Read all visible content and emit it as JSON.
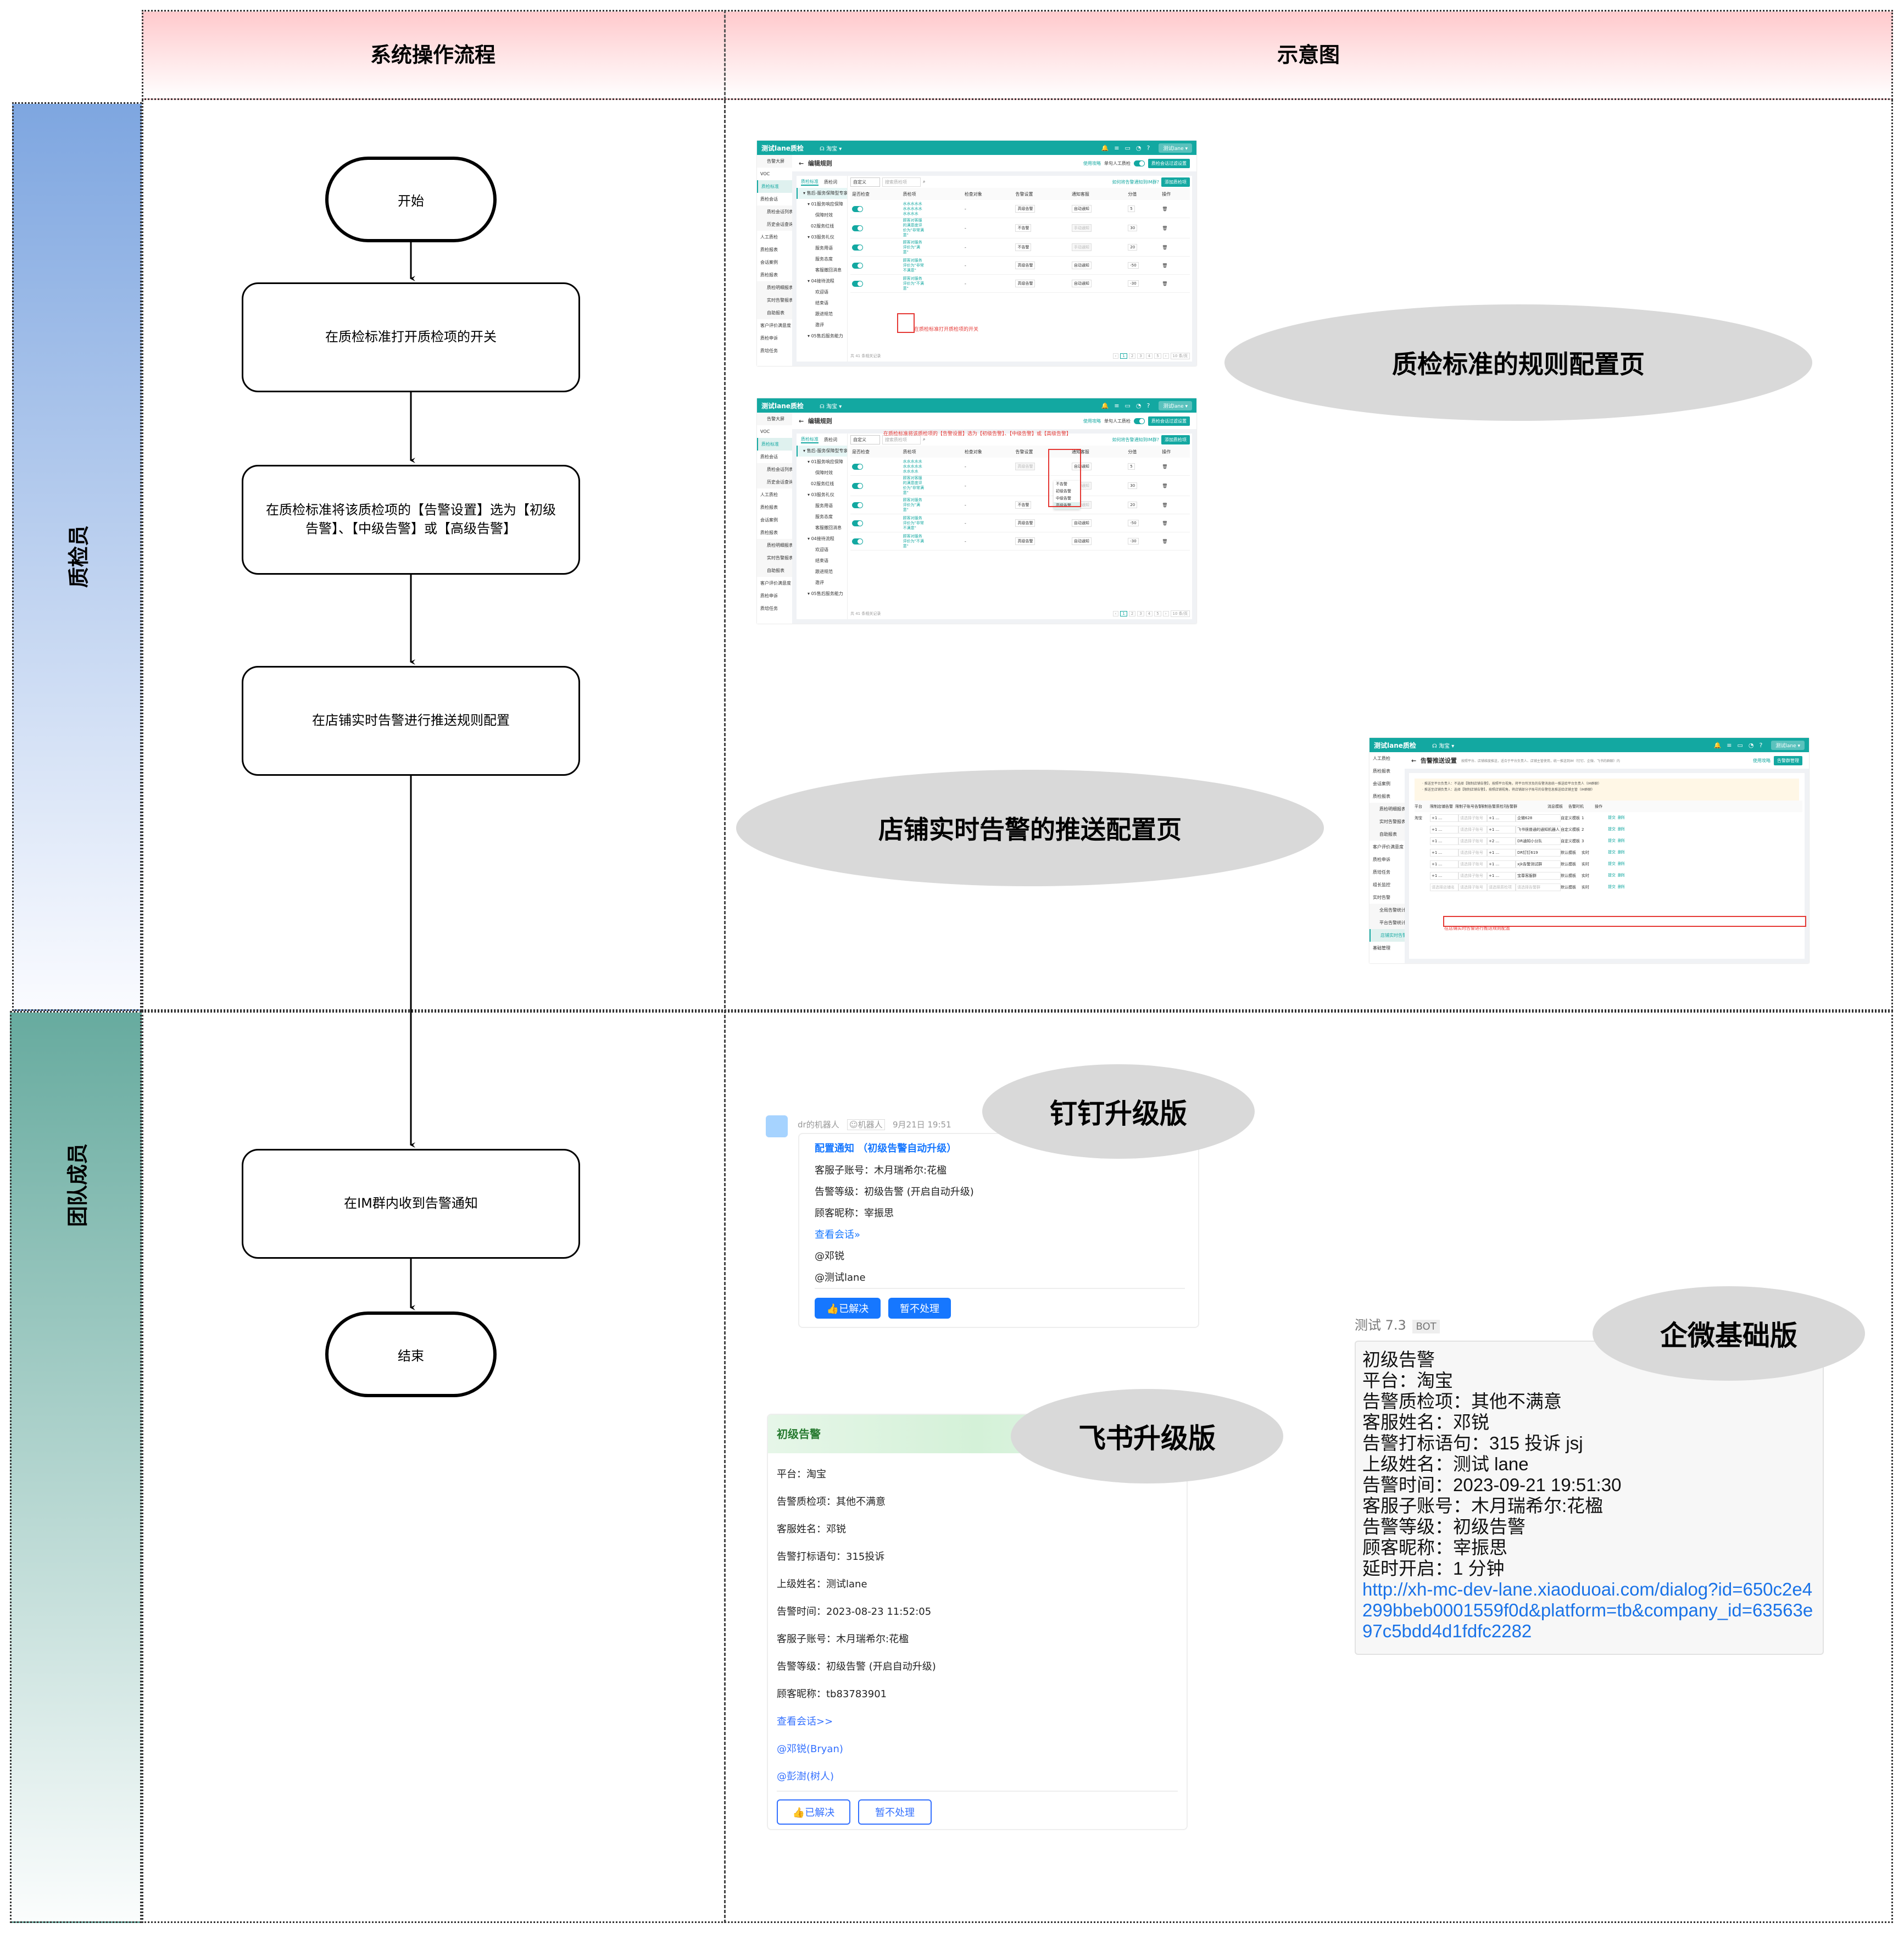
{
  "header": {
    "col_flow": "系统操作流程",
    "col_preview": "示意图"
  },
  "lanes": [
    {
      "label": "质检员",
      "color_top": "#7ea6e0"
    },
    {
      "label": "团队成员",
      "color_top": "#67ab9f"
    }
  ],
  "flow": {
    "start": "开始",
    "steps": [
      "在质检标准打开质检项的开关",
      "在质检标准将该质检项的【告警设置】选为【初级告警】、【中级告警】或【高级告警】",
      "在店铺实时告警进行推送规则配置",
      "在IM群内收到告警通知"
    ],
    "end": "结束"
  },
  "labels": {
    "rule_page": "质检标准的规则配置页",
    "push_page": "店铺实时告警的推送配置页",
    "dingtalk": "钉钉升级版",
    "feishu": "飞书升级版",
    "wecom": "企微基础版"
  },
  "app": {
    "brand": "测试lane质检",
    "platform": "淘宝 ▾",
    "user": "测试lane ▾",
    "accent": "#13a8a1",
    "sidebar": [
      "告警大屏",
      "VOC",
      "质检标准",
      "质检会话",
      "质检会话列表",
      "历史会话查询",
      "人工质检",
      "质检报表",
      "会话案例",
      "质检报表",
      "质检明细报表",
      "实时告警报表",
      "自助报表",
      "客户评价满意度",
      "质检申诉",
      "质培任务"
    ],
    "rule_page": {
      "title": "编辑规则",
      "guide_link": "使用攻略",
      "manual_label": "单句人工质检",
      "filter_button": "质检会话过滤设置",
      "tabs": [
        "质检标准",
        "质检词"
      ],
      "tree": [
        "售后-服务保障型专家",
        "01服务响应保障",
        "保障时效",
        "02服务红线",
        "03服务礼仪",
        "服务用语",
        "服务态度",
        "客服撤回消息",
        "04接待流程",
        "欢迎语",
        "结束语",
        "跟进规范",
        "邀评",
        "转接规范",
        "05售后服务能力"
      ],
      "filter_value": "自定义",
      "search_placeholder": "搜索质检项",
      "im_link": "如何将告警通知到IM群?",
      "add_button": "添加质检项",
      "columns": [
        "是否检查",
        "质检项",
        "调",
        "检查对象",
        "告警设置",
        "通知客服",
        "分值",
        "操作"
      ],
      "rows": [
        {
          "item": "水水水水水水水水水水水水水水",
          "target": "-",
          "alert": "高级告警",
          "notify": "自动通知",
          "score": "5"
        },
        {
          "item": "顾客对客服的满意度评价为\"非常满意\"",
          "target": "-",
          "alert": "不告警",
          "notify": "手动通知",
          "score": "30"
        },
        {
          "item": "顾客对服务评价为\"满意\"",
          "target": "-",
          "alert": "不告警",
          "notify": "手动通知",
          "score": "20"
        },
        {
          "item": "顾客对服务评价为\"非常不满意\"",
          "target": "-",
          "alert": "高级告警",
          "notify": "自动通知",
          "score": "-50"
        },
        {
          "item": "顾客对服务评价为\"不满意\"",
          "target": "-",
          "alert": "高级告警",
          "notify": "自动通知",
          "score": "-30"
        }
      ],
      "total": "共 41 条相关记录",
      "pages": [
        "1",
        "2",
        "3",
        "4",
        "5"
      ],
      "page_size": "10 条/页",
      "annotation1": "在质检标准打开质检项的开关",
      "annotation2": "在质检标准将该质检项的【告警设置】选为【初级告警】、【中级告警】或【高级告警】",
      "alert_options": [
        "不告警",
        "初级告警",
        "中级告警",
        "高级告警"
      ]
    },
    "push_page": {
      "title": "告警推送设置",
      "subtitle": "按照平台、店铺维度推送，适合于平台负责人、店铺主管使用，统一推送到IM（钉钉、企微、飞书的群聊）内",
      "guide_link": "使用攻略",
      "manage_button": "告警群管理",
      "sidebar": [
        "人工质检",
        "质检报表",
        "会话案例",
        "质检报表",
        "质检明细报表",
        "实时告警报表",
        "自助报表",
        "客户评价满意度",
        "质检申诉",
        "质培任务",
        "组长监控",
        "实时告警",
        "全局告警统计",
        "平台告警统计",
        "店铺实时告警",
        "基础管理"
      ],
      "notice": [
        "· 推送至平台负责人：不选择【限制店铺告警】，按照平台视角，将平台所涉及的告警消息统一推送给平台负责人（IM群聊）",
        "· 推送至店铺负责人：选择【限制店铺告警】，按照店铺视角，将店铺部分子账号的告警信息推送给店铺主管（IM群聊）"
      ],
      "columns": [
        "平台",
        "限制店铺告警",
        "限制子账号告警",
        "限制告警质检项",
        "告警群",
        "消息模板",
        "告警时机",
        "操作"
      ],
      "rows": [
        {
          "platform": "淘宝",
          "shop": "+1 ...",
          "sub": "请选择子账号",
          "item": "+1 ...",
          "group": "企微628",
          "tpl": "自定义模板",
          "timing": "1"
        },
        {
          "platform": "",
          "shop": "+1 ...",
          "sub": "请选择子账号",
          "item": "+1 ...",
          "group": "飞书很普通的通知机器人",
          "tpl": "自定义模板",
          "timing": "2"
        },
        {
          "platform": "",
          "shop": "+1 ...",
          "sub": "请选择子账号",
          "item": "+2 ...",
          "group": "DR通知小分队",
          "tpl": "自定义模板",
          "timing": "3"
        },
        {
          "platform": "",
          "shop": "+1 ...",
          "sub": "请选择子账号",
          "item": "+1 ...",
          "group": "DR钉钉619",
          "tpl": "默认模板",
          "timing": "实时"
        },
        {
          "platform": "",
          "shop": "+1 ...",
          "sub": "请选择子账号",
          "item": "+1 ...",
          "group": "xjk告警测试群",
          "tpl": "默认模板",
          "timing": "实时"
        },
        {
          "platform": "",
          "shop": "+1 ...",
          "sub": "请选择子账号",
          "item": "+1 ...",
          "group": "宝尊客服群",
          "tpl": "默认模板",
          "timing": "实时"
        },
        {
          "platform": "",
          "shop": "请选择店铺名",
          "sub": "请选择子账号",
          "item": "请选择质检项",
          "group": "请选择告警群",
          "tpl": "默认模板",
          "timing": "实时"
        }
      ],
      "actions": [
        "提交",
        "删除"
      ],
      "annotation": "在店铺实时告警进行推送规则配置"
    }
  },
  "dingtalk_card": {
    "sender": "dr的机器人",
    "badge": "机器人",
    "time": "9月21日 19:51",
    "title": "配置通知 （初级告警自动升级）",
    "lines": [
      "客服子账号：木月瑞希尔:花楹",
      "告警等级：初级告警 (开启自动升级)",
      "顾客昵称：宰振思"
    ],
    "view_link": "查看会话»",
    "mentions": [
      "@邓锐",
      "@测试lane"
    ],
    "buttons": [
      "👍已解决",
      "暂不处理"
    ]
  },
  "feishu_card": {
    "title": "初级告警",
    "lines": [
      "平台：淘宝",
      "告警质检项：其他不满意",
      "客服姓名：邓锐",
      "告警打标语句：315投诉",
      "上级姓名：测试lane",
      "告警时间：2023-08-23 11:52:05",
      "客服子账号：木月瑞希尔:花楹",
      "告警等级：初级告警  (开启自动升级)",
      "顾客昵称：tb83783901"
    ],
    "view_link": "查看会话>>",
    "mentions": [
      "@邓锐(Bryan)",
      "@彭澍(树人)"
    ],
    "buttons": [
      "👍已解决",
      "暂不处理"
    ]
  },
  "wecom_card": {
    "sender": "测试 7.3",
    "badge": "BOT",
    "lines": [
      "初级告警",
      "平台：淘宝",
      "告警质检项：其他不满意",
      "客服姓名：邓锐",
      "告警打标语句：315 投诉 jsj",
      "上级姓名：测试 lane",
      "告警时间：2023-09-21 19:51:30",
      "客服子账号：木月瑞希尔:花楹",
      "告警等级：初级告警",
      "顾客昵称：宰振思",
      "延时开启：1 分钟"
    ],
    "url": "http://xh-mc-dev-lane.xiaoduoai.com/dialog?id=650c2e4299bbeb0001559f0d&platform=tb&company_id=63563e97c5bdd4d1fdfc2282"
  }
}
